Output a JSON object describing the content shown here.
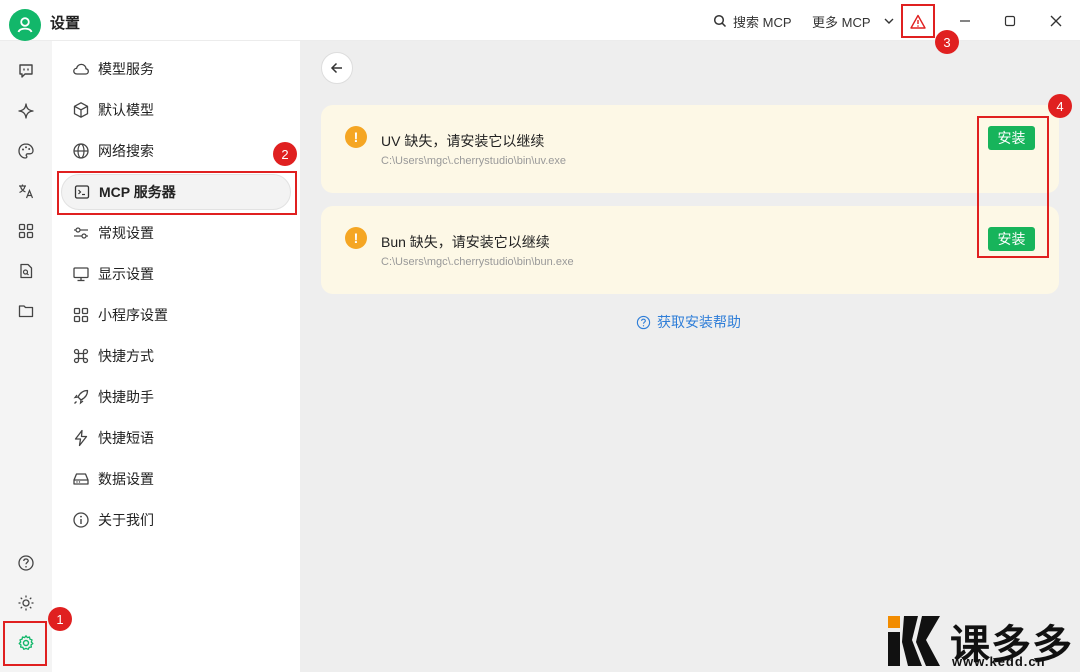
{
  "window": {
    "title": "设置",
    "search_mcp_label": "搜索 MCP",
    "more_mcp_label": "更多 MCP"
  },
  "nav": {
    "items": [
      {
        "label": "模型服务",
        "icon": "cloud-icon"
      },
      {
        "label": "默认模型",
        "icon": "cube-icon"
      },
      {
        "label": "网络搜索",
        "icon": "globe-icon"
      },
      {
        "label": "MCP 服务器",
        "icon": "terminal-icon"
      },
      {
        "label": "常规设置",
        "icon": "sliders-icon"
      },
      {
        "label": "显示设置",
        "icon": "monitor-icon"
      },
      {
        "label": "小程序设置",
        "icon": "grid-icon"
      },
      {
        "label": "快捷方式",
        "icon": "command-icon"
      },
      {
        "label": "快捷助手",
        "icon": "rocket-icon"
      },
      {
        "label": "快捷短语",
        "icon": "zap-icon"
      },
      {
        "label": "数据设置",
        "icon": "hard-drive-icon"
      },
      {
        "label": "关于我们",
        "icon": "info-icon"
      }
    ],
    "active_index": 3
  },
  "warnings": [
    {
      "title": "UV 缺失，请安装它以继续",
      "path": "C:\\Users\\mgc\\.cherrystudio\\bin\\uv.exe",
      "button": "安装"
    },
    {
      "title": "Bun 缺失，请安装它以继续",
      "path": "C:\\Users\\mgc\\.cherrystudio\\bin\\bun.exe",
      "button": "安装"
    }
  ],
  "help_link": "获取安装帮助",
  "callouts": [
    "1",
    "2",
    "3",
    "4"
  ],
  "watermark": {
    "brand": "课多多",
    "url": "www.kedd.cn"
  },
  "colors": {
    "accent": "#12b76a",
    "install": "#17b45b",
    "warning": "#f5a623",
    "callout": "#e02020",
    "link": "#2f7ed8"
  }
}
